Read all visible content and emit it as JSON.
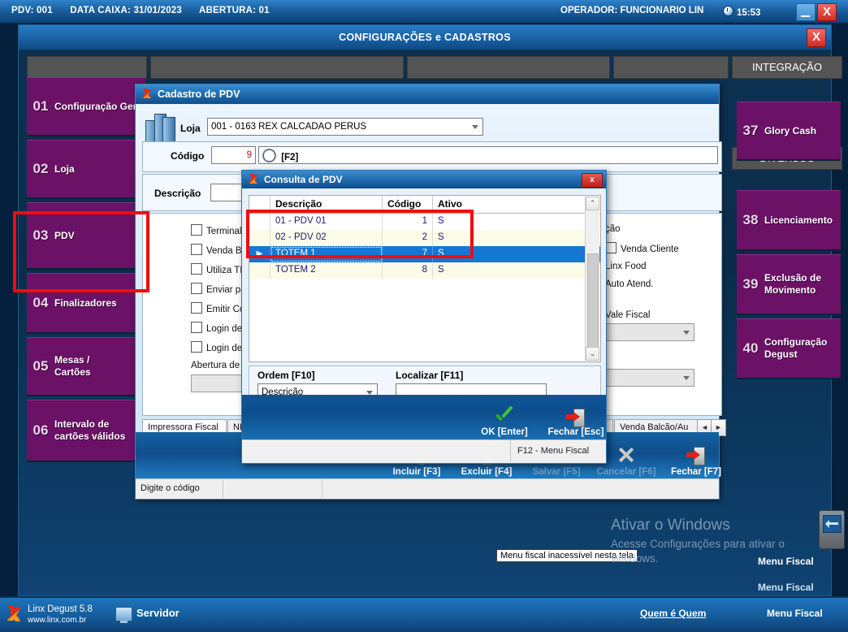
{
  "topbar": {
    "pdv": "PDV: 001",
    "data_caixa": "DATA CAIXA: 31/01/2023",
    "abertura": "ABERTURA: 01",
    "operador": "OPERADOR: FUNCIONARIO LIN",
    "clock": "15:53",
    "minimize_label": "",
    "close_label": "X"
  },
  "config_window": {
    "title": "CONFIGURAÇÕES e CADASTROS",
    "close_label": "X",
    "category_headers": [
      {
        "label": "INTEGRAÇÃO"
      },
      {
        "label": "DIVERSOS"
      }
    ],
    "left_menu": [
      {
        "num": "01",
        "label": "Configuração Geral"
      },
      {
        "num": "02",
        "label": "Loja"
      },
      {
        "num": "03",
        "label": "PDV"
      },
      {
        "num": "04",
        "label": "Finalizadores"
      },
      {
        "num": "05",
        "label": "Mesas / Cartões"
      },
      {
        "num": "06",
        "label": "Intervalo de cartões válidos"
      }
    ],
    "right_menu": [
      {
        "num": "37",
        "label": "Glory Cash"
      },
      {
        "num": "38",
        "label": "Licenciamento"
      },
      {
        "num": "39",
        "label": "Exclusão de Movimento"
      },
      {
        "num": "40",
        "label": "Configuração Degust"
      }
    ],
    "menu_fiscal_panel": "Menu Fiscal"
  },
  "cadastro": {
    "title": "Cadastro de PDV",
    "loja_label": "Loja",
    "loja_value": "001 - 0163  REX CALCADAO PERUS",
    "codigo_label": "Código",
    "codigo_value": "9",
    "search_label": "[F2]",
    "descricao_label": "Descrição",
    "descricao_value": "",
    "checkboxes_left": [
      {
        "label": "Terminal"
      },
      {
        "label": "Venda Ba"
      },
      {
        "label": "Utiliza TE"
      },
      {
        "label": "Enviar par"
      },
      {
        "label": "Emitir Con"
      },
      {
        "label": "Login de U"
      },
      {
        "label": "Login de U"
      }
    ],
    "abertura_label": "Abertura de C",
    "right_texts": [
      {
        "label": "ção"
      },
      {
        "label": "Venda Cliente",
        "checkbox": true
      },
      {
        "label": "Linx Food"
      },
      {
        "label": "Auto Atend."
      },
      {
        "label": "Vale Fiscal"
      }
    ],
    "tabs": [
      {
        "label": "Impressora Fiscal",
        "selected": true
      },
      {
        "label": "NFC-e"
      },
      {
        "label": "te"
      },
      {
        "label": "Venda Balcão/Au"
      }
    ],
    "tab_scroll_left": "◄",
    "tab_scroll_right": "►",
    "toolbar": [
      {
        "label": "Incluir [F3]",
        "icon": "new-document-icon",
        "enabled": true
      },
      {
        "label": "Excluir [F4]",
        "icon": "trash-icon",
        "enabled": true
      },
      {
        "label": "Salvar [F5]",
        "icon": "floppy-icon",
        "enabled": false
      },
      {
        "label": "Cancelar [F6]",
        "icon": "x-icon",
        "enabled": false
      },
      {
        "label": "Fechar [F7]",
        "icon": "exit-door-icon",
        "enabled": true
      }
    ],
    "status_left": "Digite o código",
    "status_tooltip": "Menu fiscal inacessível nesta tela"
  },
  "consulta": {
    "title": "Consulta de PDV",
    "close_label": "x",
    "columns": [
      "",
      "Descrição",
      "Código",
      "Ativo"
    ],
    "rows": [
      {
        "marker": "",
        "descricao": "01 - PDV 01",
        "codigo": "1",
        "ativo": "S",
        "selected": false
      },
      {
        "marker": "",
        "descricao": "02 - PDV 02",
        "codigo": "2",
        "ativo": "S",
        "selected": false
      },
      {
        "marker": "▶",
        "descricao": "TOTEM 1",
        "codigo": "7",
        "ativo": "S",
        "selected": true
      },
      {
        "marker": "",
        "descricao": "TOTEM 2",
        "codigo": "8",
        "ativo": "S",
        "selected": false
      }
    ],
    "ordem_label": "Ordem [F10]",
    "ordem_value": "Descrição",
    "localizar_label": "Localizar [F11]",
    "localizar_value": "",
    "ok_label": "OK [Enter]",
    "fechar_label": "Fechar [Esc]",
    "status_right": "F12 - Menu Fiscal",
    "scroll_up": "⌃",
    "scroll_down": "⌄"
  },
  "watermark": {
    "line1": "Ativar o Windows",
    "line2": "Acesse Configurações para ativar o Windows."
  },
  "appbar": {
    "product": "Linx Degust 5.8",
    "url": "www.linx.com.br",
    "servidor": "Servidor",
    "quem": "Quem é Quem",
    "menu_fiscal": "Menu Fiscal"
  },
  "colors": {
    "accent_blue": "#1a6fb4",
    "menu_purple": "#6b1166",
    "highlight_red": "#f30b0b",
    "row_selected": "#1577d1"
  }
}
